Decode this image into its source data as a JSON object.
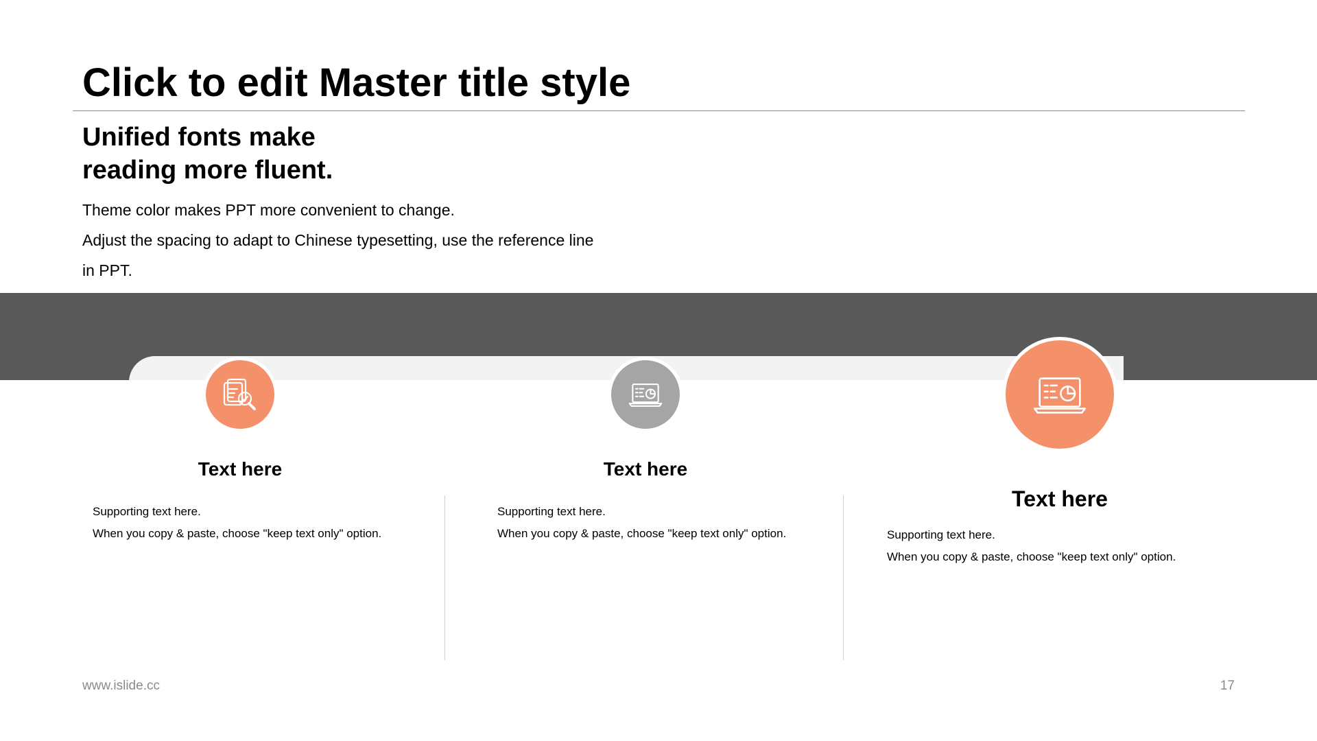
{
  "slide": {
    "title": "Click to edit Master title style",
    "subtitle": [
      "Unified fonts make",
      "reading more fluent."
    ],
    "body": [
      "Theme color makes PPT more convenient to change.",
      "Adjust the spacing to adapt to Chinese typesetting, use the reference line",
      "in PPT."
    ]
  },
  "columns": [
    {
      "icon": "document-search-icon",
      "circle_color": "#f4916a",
      "title": "Text here",
      "lines": [
        "Supporting text here.",
        "When you copy & paste, choose \"keep text only\" option."
      ]
    },
    {
      "icon": "laptop-chart-icon",
      "circle_color": "#a5a5a5",
      "title": "Text here",
      "lines": [
        "Supporting text here.",
        "When you copy & paste, choose \"keep text only\" option."
      ]
    },
    {
      "icon": "laptop-chart-icon",
      "circle_color": "#f4916a",
      "title": "Text here",
      "lines": [
        "Supporting text here.",
        "When you copy & paste, choose \"keep text only\" option."
      ]
    }
  ],
  "footer": {
    "url": "www.islide.cc",
    "page": "17"
  },
  "colors": {
    "accent": "#f4916a",
    "neutral": "#a5a5a5",
    "band": "#595959"
  }
}
